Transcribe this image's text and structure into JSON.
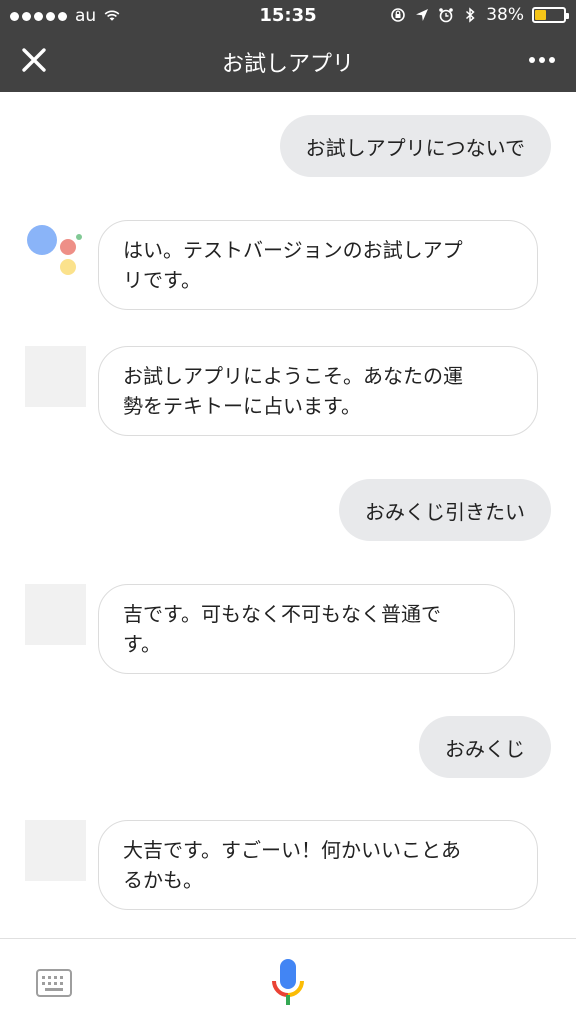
{
  "status": {
    "carrier": "au",
    "time": "15:35",
    "battery": "38%",
    "battery_level": 0.38,
    "battery_color": "#f5c518"
  },
  "toolbar": {
    "title": "お試しアプリ",
    "close_icon": "close-icon",
    "more_icon": "more-icon"
  },
  "messages": [
    {
      "from": "user",
      "text": "お試しアプリにつないで"
    },
    {
      "from": "assistant",
      "lines": [
        "はい。テストバージョンのお試しアプ",
        "リです。"
      ]
    },
    {
      "from": "app",
      "lines": [
        "お試しアプリにようこそ。あなたの運",
        "勢をテキトーに占います。"
      ]
    },
    {
      "from": "user",
      "text": "おみくじ引きたい"
    },
    {
      "from": "app",
      "lines": [
        "吉です。可もなく不可もなく普通で",
        "す。"
      ]
    },
    {
      "from": "user",
      "text": "おみくじ"
    },
    {
      "from": "app",
      "lines": [
        "大吉です。すごーい！何かいいことあ",
        "るかも。"
      ]
    }
  ],
  "colors": {
    "header_bg": "#424242",
    "user_bubble_bg": "#e8e9eb",
    "google_blue": "#4285f4",
    "google_red": "#ea4335",
    "google_yellow": "#fbbc05",
    "google_green": "#34a853"
  }
}
